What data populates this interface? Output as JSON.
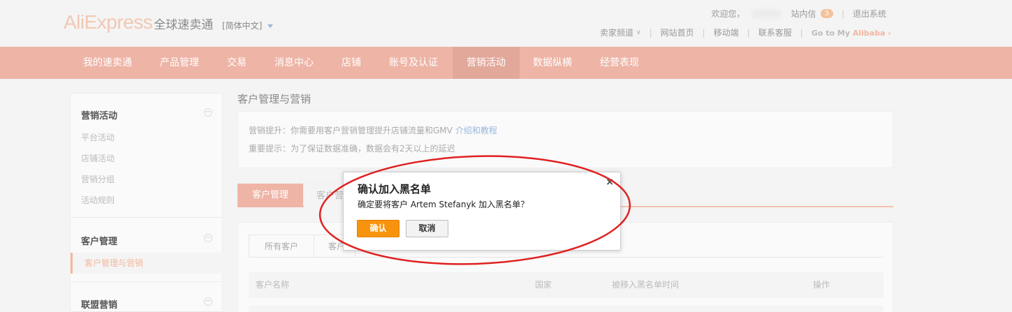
{
  "header": {
    "logo_main": "AliExpress",
    "logo_sub": "全球速卖通",
    "language": "[简体中文]",
    "welcome": "欢迎您，",
    "inbox_label": "站内信",
    "inbox_count": "3",
    "logout": "退出系统",
    "links": [
      "卖家频道",
      "网站首页",
      "移动端",
      "联系客服"
    ],
    "goto_prefix": "Go to My",
    "goto_brand": "Alibaba ›"
  },
  "nav": {
    "items": [
      "我的速卖通",
      "产品管理",
      "交易",
      "消息中心",
      "店铺",
      "账号及认证",
      "营销活动",
      "数据纵横",
      "经营表现"
    ],
    "active": "营销活动"
  },
  "sidebar": {
    "sections": [
      {
        "title": "营销活动",
        "items": [
          "平台活动",
          "店铺活动",
          "营销分组",
          "活动规则"
        ]
      },
      {
        "title": "客户管理",
        "items": [
          "客户管理与营销"
        ]
      },
      {
        "title": "联盟营销",
        "items": []
      }
    ],
    "collapse_glyph": "−"
  },
  "main": {
    "title": "客户管理与营销",
    "info_line1": "营销提升：你需要用客户营销管理提升店铺流量和GMV",
    "info_link": "介绍和教程",
    "info_line2": "重要提示：为了保证数据准确，数据会有2天以上的延迟",
    "tabs": [
      "客户管理",
      "客户营"
    ],
    "subtabs": [
      "所有客户",
      "客户"
    ],
    "table_headers": [
      "客户名称",
      "国家",
      "被移入黑名单时间",
      "操作"
    ]
  },
  "modal": {
    "title": "确认加入黑名单",
    "message": "确定要将客户 Artem Stefanyk 加入黑名单？",
    "close_glyph": "×",
    "confirm": "确认",
    "cancel": "取消"
  },
  "colors": {
    "nav_bg": "#eeb4a6",
    "confirm_bg": "#f7930d",
    "annotation": "#e02020"
  }
}
